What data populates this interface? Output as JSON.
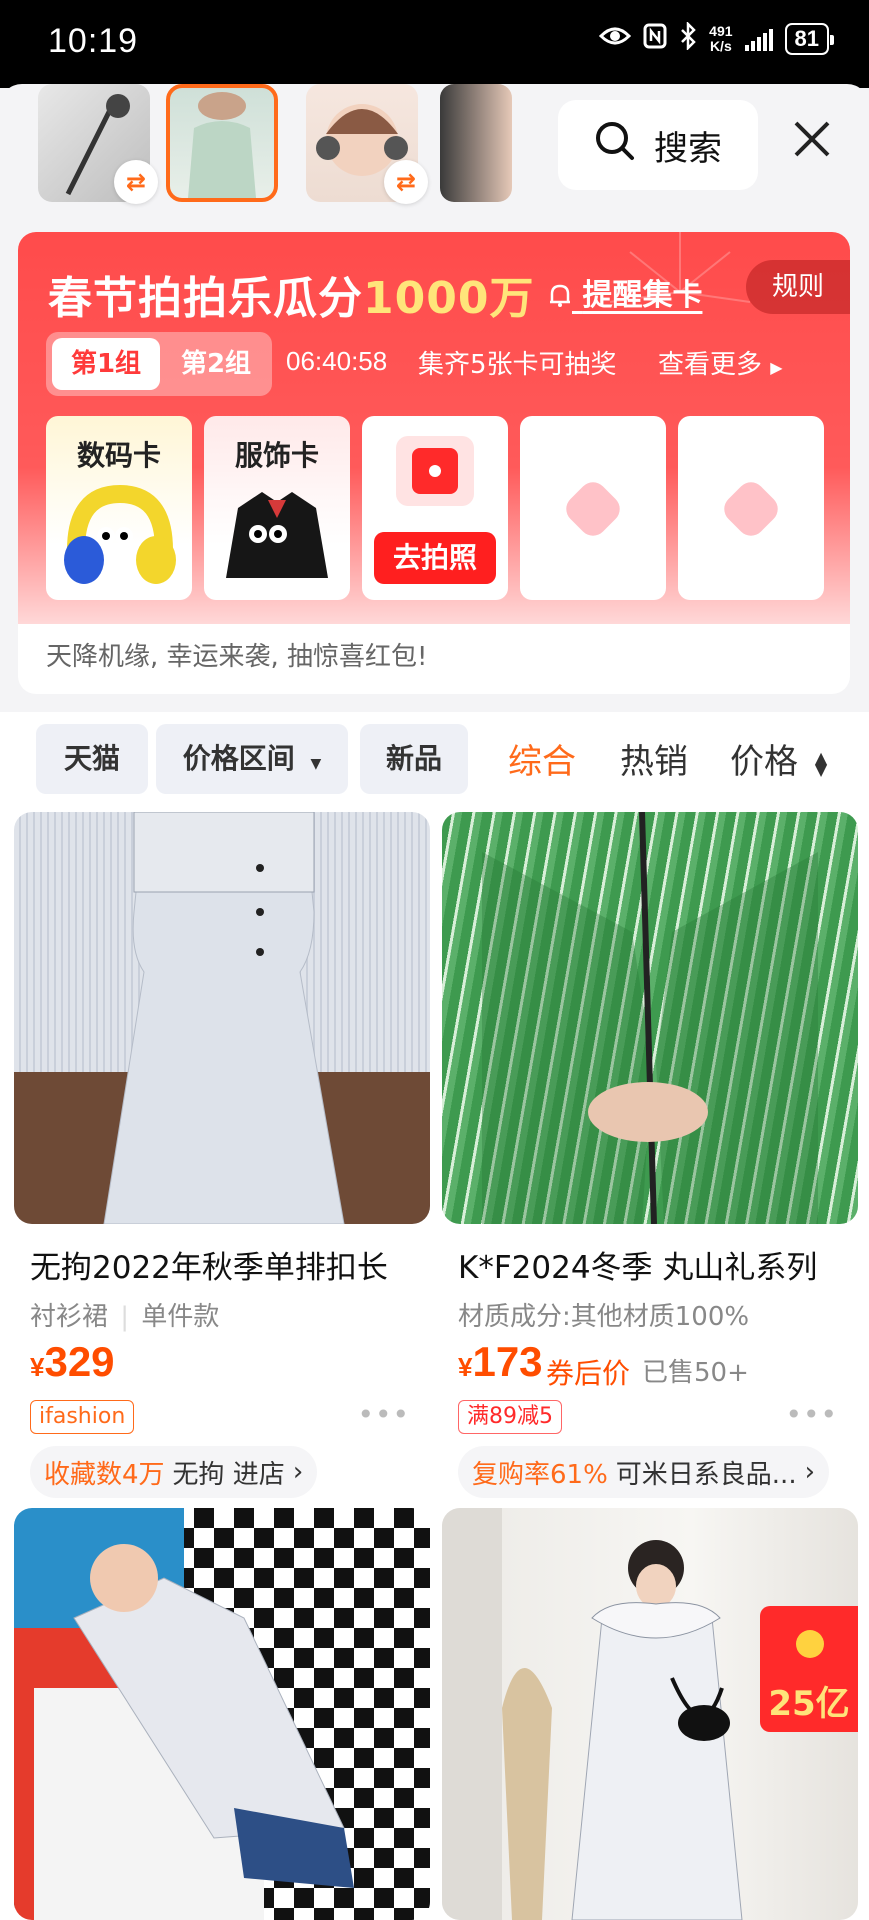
{
  "status_bar": {
    "time": "10:19",
    "net_speed": "491",
    "net_unit": "K/s",
    "battery": "81"
  },
  "top": {
    "search_label": "搜索",
    "close_icon": "close-icon"
  },
  "promo": {
    "title_main": "春节拍拍乐瓜分",
    "title_amount": "1000万",
    "remind_label": "提醒集卡",
    "rules_label": "规则",
    "groups": [
      "第1组",
      "第2组"
    ],
    "countdown": "06:40:58",
    "collect_text": "集齐5张卡可抽奖",
    "more_label": "查看更多",
    "cards": [
      {
        "label": "数码卡"
      },
      {
        "label": "服饰卡"
      },
      {
        "label": "去拍照"
      }
    ],
    "footer": "天降机缘, 幸运来袭, 抽惊喜红包!"
  },
  "filters": {
    "chips": [
      "天猫",
      "价格区间",
      "新品"
    ],
    "sorts": [
      "综合",
      "热销",
      "价格"
    ]
  },
  "products": [
    {
      "title": "无拘2022年秋季单排扣长",
      "sub1": "衬衫裙",
      "sub2": "单件款",
      "yen": "¥",
      "price": "329",
      "tag": "ifashion",
      "store_highlight": "收藏数4万",
      "store_name": "无拘 进店"
    },
    {
      "title": "K*F2024冬季 丸山礼系列",
      "sub1": "材质成分:其他材质100%",
      "yen": "¥",
      "price": "173",
      "after_label": "券后价",
      "sold": "已售50+",
      "tag": "满89减5",
      "store_highlight": "复购率61%",
      "store_name": "可米日系良品..."
    },
    {
      "badge": "25亿"
    }
  ]
}
